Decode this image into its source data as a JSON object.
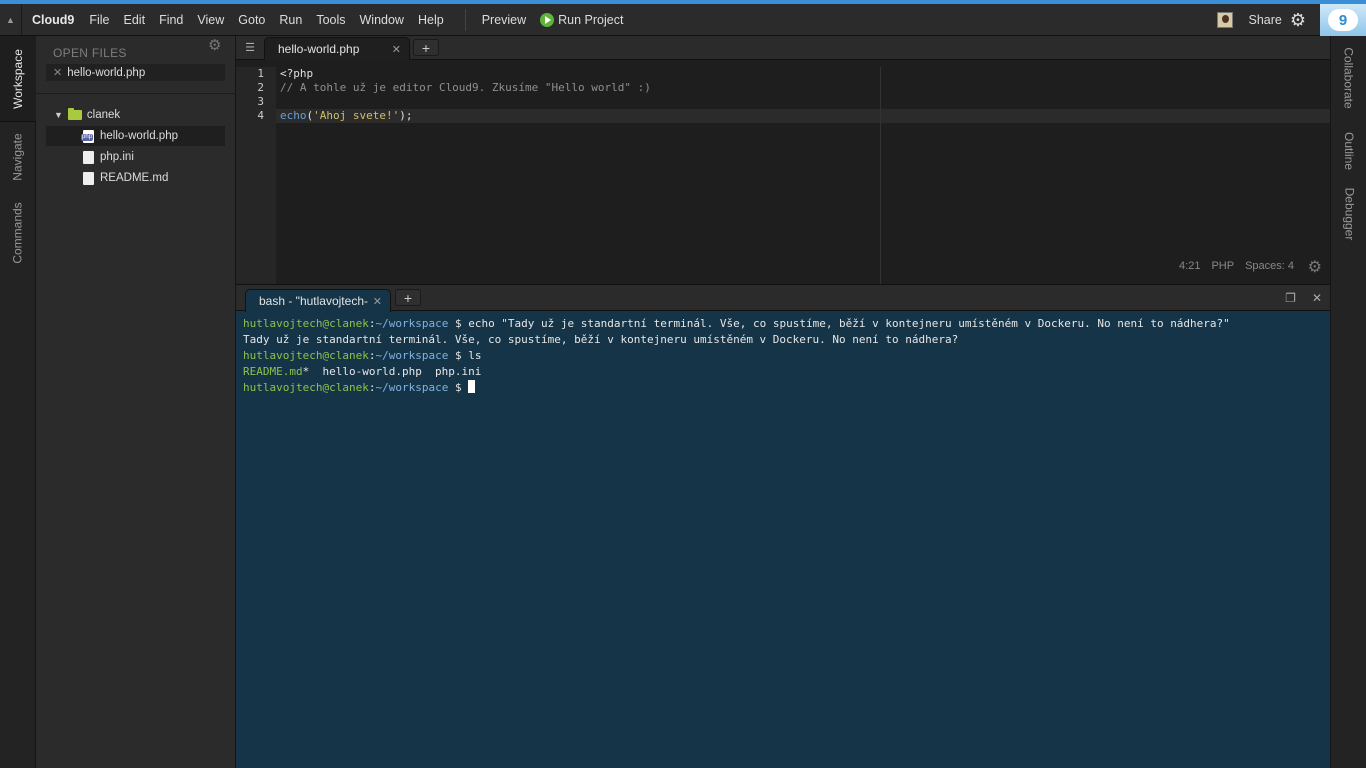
{
  "menubar": {
    "brand": "Cloud9",
    "items": [
      "File",
      "Edit",
      "Find",
      "View",
      "Goto",
      "Run",
      "Tools",
      "Window",
      "Help"
    ],
    "preview": "Preview",
    "run_project": "Run Project",
    "share": "Share",
    "logo_text": "9"
  },
  "left_tabs": [
    "Workspace",
    "Navigate",
    "Commands"
  ],
  "right_tabs": [
    "Collaborate",
    "Outline",
    "Debugger"
  ],
  "open_files": {
    "title": "OPEN FILES",
    "items": [
      "hello-world.php"
    ]
  },
  "tree": {
    "folder": "clanek",
    "files": [
      "hello-world.php",
      "php.ini",
      "README.md"
    ]
  },
  "editor": {
    "tab_label": "hello-world.php",
    "line_numbers": [
      "1",
      "2",
      "3",
      "4"
    ],
    "lines": {
      "l1": "<?php",
      "l2": "// A tohle už je editor Cloud9. Zkusíme \"Hello world\" :)",
      "l4_fn": "echo",
      "l4_open": "(",
      "l4_str": "'Ahoj svete!'",
      "l4_close": ");"
    },
    "status": {
      "cursor_pos": "4:21",
      "language": "PHP",
      "indent": "Spaces: 4"
    }
  },
  "terminal": {
    "tab_label": "bash - \"hutlavojtech-",
    "user": "hutlavojtech@clanek",
    "path": "~/workspace",
    "cmd1": "$ echo \"Tady už je standartní terminál. Vše, co spustíme, běží v kontejneru umístěném v Dockeru. No není to nádhera?\"",
    "out1": "Tady už je standartní terminál. Vše, co spustíme, běží v kontejneru umístěném v Dockeru. No není to nádhera?",
    "cmd2": "$ ls",
    "ls_readme": "README.md",
    "ls_rest": "*  hello-world.php  php.ini",
    "prompt_end": "$ "
  },
  "colors": {
    "accent": "#3a8fd6",
    "terminal_bg": "#153448",
    "folder": "#a9c93f",
    "run_green": "#5fb33a"
  }
}
